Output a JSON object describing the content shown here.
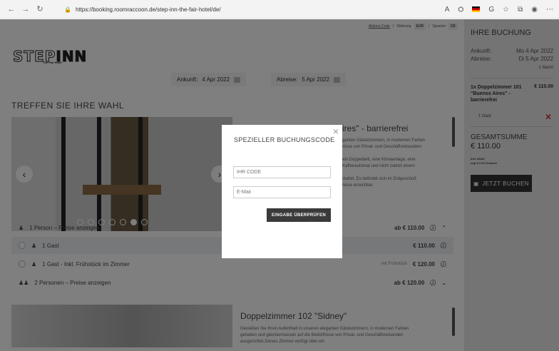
{
  "browser": {
    "url": "https://booking.roomraccoon.de/step-inn-the-fair-hotel/de/",
    "reader_label": "A",
    "icons": [
      "back-icon",
      "forward-icon",
      "reload-icon",
      "lock-icon",
      "flag-icon",
      "tracker-icon",
      "favorite-icon",
      "collections-icon",
      "profile-icon",
      "more-icon"
    ]
  },
  "topbar": {
    "promo_link": "Aktions-Code",
    "currency_label": "Währung",
    "currency": "EUR",
    "language_label": "Sprache",
    "language": "DE"
  },
  "logo": {
    "step": "STEP",
    "inn": "INN",
    "sub": "The Fair Hotel"
  },
  "dates": {
    "arrival_label": "Ankunft:",
    "arrival": "4 Apr 2022",
    "departure_label": "Abreise:",
    "departure": "5 Apr 2022"
  },
  "section_title": "TREFFEN SIE IHRE WAHL",
  "room1": {
    "title_visible": "ires\" - barrierefrei",
    "desc_lines": [
      "ganten Gästezimmern, in modernen Farben",
      "nisse von Privat- und Geschäftsreisenden",
      "",
      "ein Doppelbett, eine Klimaanlage, eine",
      "Kaffeeautomat und nicht zuletzt einem",
      "",
      "stattet. Es befindet sich im Erdgeschoß",
      "nisse erreichbar."
    ]
  },
  "rows": {
    "one_person": "1 Person – Preise anzeigen",
    "one_person_price": "ab € 110.00",
    "guest1": "1 Gast",
    "guest1_price": "€ 110.00",
    "guest2": "1 Gast - Inkl. Frühstück im Zimmer",
    "guest2_tag": "mit Frühstück",
    "guest2_price": "€ 120.00",
    "two_persons": "2 Personen – Preise anzeigen",
    "two_persons_price": "ab € 120.00"
  },
  "room2": {
    "title": "Doppelzimmer 102 \"Sidney\"",
    "desc_lines": [
      "Genießen Sie Ihren Aufenthalt in unseren eleganten Gästezimmern, in modernen Farben",
      "gehalten und gleichermassen auf die Bedürfnisse von Privat- und Geschäftsreisenden",
      "ausgerichtet.Dieses Zimmer verfügt über ein"
    ]
  },
  "sidebar": {
    "title": "IHRE BUCHUNG",
    "arrival_label": "Ankunft:",
    "arrival": "Mo 4 Apr 2022",
    "departure_label": "Abreise:",
    "departure": "Di 5 Apr 2022",
    "nights": "1 Nacht",
    "room_line": "1x Doppelzimmer 101 \"Buenos Aires\" - barrierefrei",
    "room_price": "€ 110.00",
    "guests": "1 Gast",
    "total_title": "GESAMTSUMME",
    "total": "€ 110.00",
    "vat": "Inkl. MwSt",
    "tax": "zzgl € 0.00 Ortstaxe",
    "book_button": "JETZT BUCHEN"
  },
  "modal": {
    "title": "SPEZIELLER BUCHUNGSCODE",
    "code_placeholder": "IHR CODE",
    "email_placeholder": "E-Mail",
    "submit": "EINGABE ÜBERPRÜFEN",
    "close": "×"
  }
}
